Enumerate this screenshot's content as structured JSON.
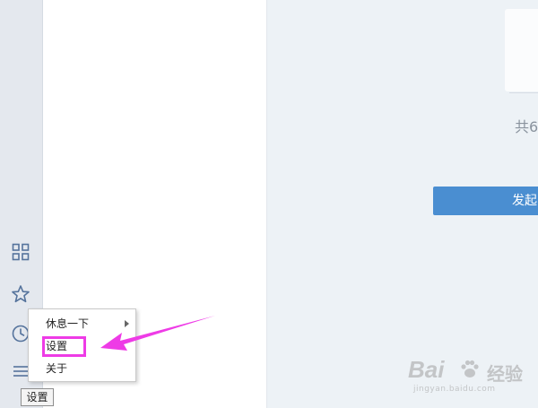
{
  "sidebar": {
    "icons": [
      "apps-grid-icon",
      "star-icon",
      "clock-icon",
      "menu-icon"
    ]
  },
  "main": {
    "count_text": "共6",
    "primary_button_label": "发起"
  },
  "context_menu": {
    "items": [
      {
        "label": "休息一下",
        "has_submenu": true
      },
      {
        "label": "设置",
        "has_submenu": false
      },
      {
        "label": "关于",
        "has_submenu": false
      }
    ]
  },
  "tooltip": {
    "text": "设置"
  },
  "annotation": {
    "highlight_color": "#ee3be6"
  },
  "colors": {
    "sidebar_icon": "#55739c",
    "primary_button": "#4a8ed1",
    "main_background": "#edf2f6"
  }
}
